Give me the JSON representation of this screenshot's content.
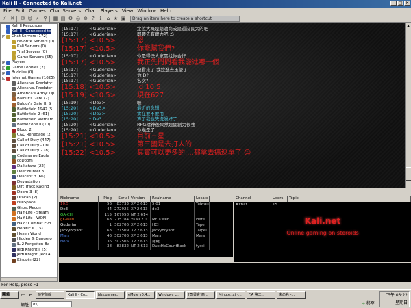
{
  "window": {
    "title": "Kali II - Connected to Kali.net"
  },
  "menu": [
    "File",
    "Edit",
    "Games",
    "Chat Servers",
    "Chat",
    "Players",
    "View",
    "Window",
    "Help"
  ],
  "toolbar": {
    "shortcut_hint": "Drag an item here to create a shortcut"
  },
  "sidebar": {
    "items": [
      {
        "label": "Kali II Resources",
        "indent": 0,
        "exp": "",
        "color": "#3060c0"
      },
      {
        "label": "Kali II - Connected to",
        "indent": 0,
        "exp": "",
        "color": "#3060c0",
        "selected": true
      },
      {
        "label": "Chat Servers (172)",
        "indent": 0,
        "exp": "-",
        "color": "#c0a030"
      },
      {
        "label": "Favorite Servers (0)",
        "indent": 1,
        "exp": "",
        "color": "#c0a030"
      },
      {
        "label": "Kali Servers (0)",
        "indent": 1,
        "exp": "",
        "color": "#c0a030"
      },
      {
        "label": "Trial Servers (0)",
        "indent": 1,
        "exp": "",
        "color": "#c0a030"
      },
      {
        "label": "Game Servers (55)",
        "indent": 1,
        "exp": "",
        "color": "#c0a030"
      },
      {
        "label": "Players",
        "indent": 0,
        "exp": "+",
        "color": "#3060c0"
      },
      {
        "label": "Game Lobbies (2)",
        "indent": 0,
        "exp": "+",
        "color": "#30a030"
      },
      {
        "label": "Buddies (0)",
        "indent": 0,
        "exp": "+",
        "color": "#3060c0"
      },
      {
        "label": "Internet Games (1625)",
        "indent": 0,
        "exp": "-",
        "color": "#c03030"
      },
      {
        "label": "Aliens vs. Predator",
        "indent": 1,
        "exp": "",
        "color": "#606060"
      },
      {
        "label": "Aliens vs. Predator",
        "indent": 1,
        "exp": "",
        "color": "#606060"
      },
      {
        "label": "America's Army: Op",
        "indent": 1,
        "exp": "",
        "color": "#806040"
      },
      {
        "label": "Baldur's Gate (2)",
        "indent": 1,
        "exp": "",
        "color": "#a06030"
      },
      {
        "label": "Baldur's Gate II: S",
        "indent": 1,
        "exp": "",
        "color": "#a06030"
      },
      {
        "label": "Battlefield 1942 (5",
        "indent": 1,
        "exp": "",
        "color": "#506030"
      },
      {
        "label": "Battlefield 2 (61)",
        "indent": 1,
        "exp": "",
        "color": "#506030"
      },
      {
        "label": "Battlefield Vietnam",
        "indent": 1,
        "exp": "",
        "color": "#506030"
      },
      {
        "label": "BattleZone II (10)",
        "indent": 1,
        "exp": "",
        "color": "#607080"
      },
      {
        "label": "Blood 2",
        "indent": 1,
        "exp": "",
        "color": "#a02020"
      },
      {
        "label": "C&C Renegade (2",
        "indent": 1,
        "exp": "",
        "color": "#808030"
      },
      {
        "label": "Call of Duty (447)",
        "indent": 1,
        "exp": "",
        "color": "#605040"
      },
      {
        "label": "Call of Duty - Uni",
        "indent": 1,
        "exp": "",
        "color": "#605040"
      },
      {
        "label": "Call of Duty 2 (8)",
        "indent": 1,
        "exp": "",
        "color": "#605040"
      },
      {
        "label": "Codename Eagle",
        "indent": 1,
        "exp": "",
        "color": "#507060"
      },
      {
        "label": "coDoom",
        "indent": 1,
        "exp": "",
        "color": "#905020"
      },
      {
        "label": "Daikatana (22)",
        "indent": 1,
        "exp": "",
        "color": "#603080"
      },
      {
        "label": "Deer Hunter 3",
        "indent": 1,
        "exp": "",
        "color": "#608040"
      },
      {
        "label": "Descent 3 (66)",
        "indent": 1,
        "exp": "",
        "color": "#405080"
      },
      {
        "label": "Devastation",
        "indent": 1,
        "exp": "",
        "color": "#803030"
      },
      {
        "label": "Dirt Track Racing",
        "indent": 1,
        "exp": "",
        "color": "#806020"
      },
      {
        "label": "Doom 3 (8)",
        "indent": 1,
        "exp": "",
        "color": "#a03020"
      },
      {
        "label": "Drakan (2)",
        "indent": 1,
        "exp": "",
        "color": "#704030"
      },
      {
        "label": "FireSpace",
        "indent": 1,
        "exp": "",
        "color": "#c04020"
      },
      {
        "label": "Ghost Recon",
        "indent": 1,
        "exp": "",
        "color": "#506050"
      },
      {
        "label": "Half-Life - Steam",
        "indent": 1,
        "exp": "",
        "color": "#d07020"
      },
      {
        "label": "Half-Life - WON",
        "indent": 1,
        "exp": "",
        "color": "#d07020"
      },
      {
        "label": "Halo: Combat Evo",
        "indent": 1,
        "exp": "",
        "color": "#406080"
      },
      {
        "label": "Heretic II (15)",
        "indent": 1,
        "exp": "",
        "color": "#605030"
      },
      {
        "label": "Hexen World",
        "indent": 1,
        "exp": "",
        "color": "#605030"
      },
      {
        "label": "Hidden & Dangero",
        "indent": 1,
        "exp": "",
        "color": "#505050"
      },
      {
        "label": "IL-2 Forgotten Ba",
        "indent": 1,
        "exp": "",
        "color": "#607080"
      },
      {
        "label": "Jedi Knight II (5)",
        "indent": 1,
        "exp": "",
        "color": "#303060"
      },
      {
        "label": "Jedi Knight: Jedi A",
        "indent": 1,
        "exp": "",
        "color": "#303060"
      },
      {
        "label": "Kingpin (22)",
        "indent": 1,
        "exp": "",
        "color": "#704020"
      }
    ]
  },
  "chat": {
    "lines": [
      {
        "ts": "[15:17]",
        "nick": "<Guderian>",
        "msg": "定位大概是給油商或是還沒長大的吧",
        "color": "#e0e0e0",
        "big": false
      },
      {
        "ts": "[15:17]",
        "nick": "<Guderian>",
        "msg": "即要先有實力吧 :S",
        "color": "#e0e0e0",
        "big": false
      },
      {
        "ts": "[15:17]",
        "nick": "<10.5>",
        "msg": "恩",
        "color": "#e02020",
        "big": true
      },
      {
        "ts": "[15:17]",
        "nick": "<10.5>",
        "msg": "你能幫我們?",
        "color": "#e02020",
        "big": true
      },
      {
        "ts": "[15:17]",
        "nick": "<Guderian>",
        "msg": "你是得快人家需找你合作",
        "color": "#e0e0e0",
        "big": false
      },
      {
        "ts": "[15:17]",
        "nick": "<10.5>",
        "msg": "我正先問問看我能進哪一個",
        "color": "#e02020",
        "big": true
      },
      {
        "ts": "[15:17]",
        "nick": "<Guderian>",
        "msg": "但看來了 我拉進去玉瑩了",
        "color": "#e0e0e0",
        "big": false
      },
      {
        "ts": "[15:17]",
        "nick": "<Guderian>",
        "msg": "你ID?",
        "color": "#e0e0e0",
        "big": false
      },
      {
        "ts": "[15:17]",
        "nick": "<Guderian>",
        "msg": "名次?",
        "color": "#e0e0e0",
        "big": false
      },
      {
        "ts": "[15:18]",
        "nick": "<10.5>",
        "msg": "id 10.5",
        "color": "#e02020",
        "big": true
      },
      {
        "ts": "[15:19]",
        "nick": "<10.5>",
        "msg": "現在627",
        "color": "#e02020",
        "big": true
      },
      {
        "ts": "[15:19]",
        "nick": "<De3>",
        "msg": "喔",
        "color": "#e0e0e0",
        "big": false
      },
      {
        "ts": "[15:20]",
        "nick": "<De3>",
        "msg": "最近的念想",
        "color": "#50c8e0",
        "big": false
      },
      {
        "ts": "[15:20]",
        "nick": "<De3>",
        "msg": "實在要不要用",
        "color": "#50c8e0",
        "big": false
      },
      {
        "ts": "[15:20]",
        "nick": "* De3",
        "msg": "算了我也先洗澡好了",
        "color": "#50c8e0",
        "big": false
      },
      {
        "ts": "[15:20]",
        "nick": "<Guderian>",
        "msg": "RPG精神後果然是開創力很強",
        "color": "#e0e0e0",
        "big": false
      },
      {
        "ts": "[15:20]",
        "nick": "<Guderian>",
        "msg": "你幾是了",
        "color": "#e0e0e0",
        "big": false
      },
      {
        "ts": "[15:21]",
        "nick": "<10.5>",
        "msg": "目前三星",
        "color": "#e02020",
        "big": true
      },
      {
        "ts": "[15:21]",
        "nick": "<10.5>",
        "msg": "第三國是去打人的",
        "color": "#e02020",
        "big": true
      },
      {
        "ts": "[15:22]",
        "nick": "<10.5>",
        "msg": "其實可以更多的....都拿去搞巡單了 😊",
        "color": "#e02020",
        "big": true
      }
    ]
  },
  "users": {
    "headers": [
      "Nickname",
      "Ping",
      "Serial",
      "Version",
      "Realname",
      "Locate"
    ],
    "rows": [
      {
        "nick": "10.5",
        "ping": "56",
        "serial": "83733",
        "ver": "XP 2.613",
        "real": "5.01",
        "loc": "Taiwan",
        "color": "#e04040"
      },
      {
        "nick": "De3",
        "ping": "44",
        "serial": "272925",
        "ver": "XP 2.613",
        "real": "de3",
        "loc": "",
        "color": "#e0e0e0"
      },
      {
        "nick": "OA-CH",
        "ping": "115",
        "serial": "167958",
        "ver": "NT 2.614",
        "real": "",
        "loc": "",
        "color": "#40e040"
      },
      {
        "nick": "gK-Web",
        "ping": "63",
        "serial": "215784",
        "ver": "xKali 2.0",
        "real": "Mr. KWeb",
        "loc": "Here",
        "color": "#e06020"
      },
      {
        "nick": "Guderian",
        "ping": "1",
        "serial": "302706",
        "ver": "XP 2.613",
        "real": "HCH",
        "loc": "Tapei",
        "color": "#e0e0e0"
      },
      {
        "nick": "JackyBryant",
        "ping": "63",
        "serial": "31509",
        "ver": "XP 2.613",
        "real": "JackyBryant",
        "loc": "Taipei",
        "color": "#e0e0e0"
      },
      {
        "nick": "Mars",
        "ping": "46",
        "serial": "302706",
        "ver": "XP 2.613",
        "real": "Mars",
        "loc": "Mars",
        "color": "#5080e0"
      },
      {
        "nick": "Nora",
        "ping": "36",
        "serial": "302505",
        "ver": "XP 2.613",
        "real": "諾羅",
        "loc": "",
        "color": "#5080e0"
      },
      {
        "nick": "",
        "ping": "38",
        "serial": "83832",
        "ver": "NT 2.613",
        "real": "DustHeCountBack",
        "loc": "tyssi",
        "color": "#e0e0e0"
      }
    ]
  },
  "channels": {
    "headers": [
      "Channel",
      "Users",
      "Topic"
    ],
    "rows": [
      {
        "name": "#chat",
        "users": "15",
        "topic": ""
      }
    ],
    "logo_title": "Kali.net",
    "logo_sub": "Online gaming on steroids"
  },
  "status": {
    "text": "For Help, press F1"
  },
  "taskbar": {
    "start_label": "開始",
    "tasks": [
      "時空陣線",
      "Kali II - Co...",
      "bbs.gamer...",
      "eMule v0.4...",
      "Windows L...",
      "[司書會]商...",
      "Minute.txt -...",
      "F.A 第二...",
      "未命名 -..."
    ],
    "address_label": "網址",
    "address_value": "d:\\",
    "go_label": "移至",
    "clock_time": "下午 03:22",
    "clock_day": "星期日"
  }
}
